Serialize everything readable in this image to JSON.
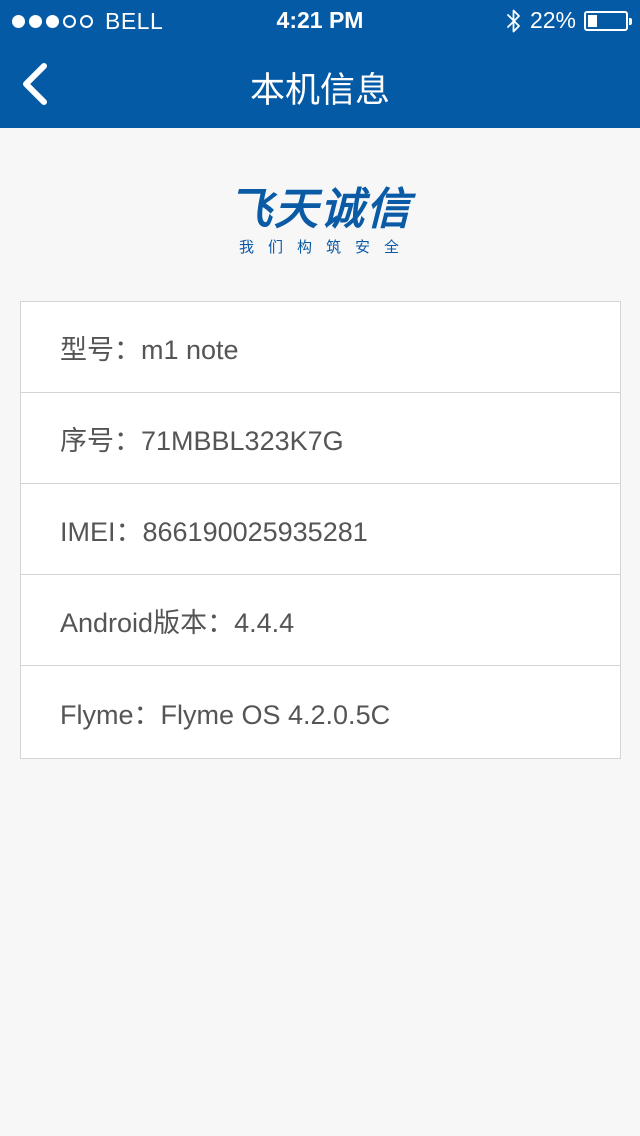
{
  "status_bar": {
    "signal_filled": 3,
    "signal_total": 5,
    "carrier": "BELL",
    "time": "4:21 PM",
    "battery": "22%",
    "battery_level": 0.22
  },
  "nav": {
    "title": "本机信息",
    "back_icon": "chevron-left-icon"
  },
  "logo": {
    "main": "飞天诚信",
    "tagline": "我们构筑安全"
  },
  "info": [
    {
      "text": "型号：m1 note"
    },
    {
      "text": "序号：71MBBL323K7G"
    },
    {
      "text": "IMEI：866190025935281"
    },
    {
      "text": "Android版本：4.4.4"
    },
    {
      "text": "Flyme：Flyme OS 4.2.0.5C"
    }
  ],
  "colors": {
    "header": "#045aa5",
    "background": "#f7f7f7",
    "logo": "#0a5aa6",
    "text": "#555555",
    "border": "#d4d4d4"
  }
}
